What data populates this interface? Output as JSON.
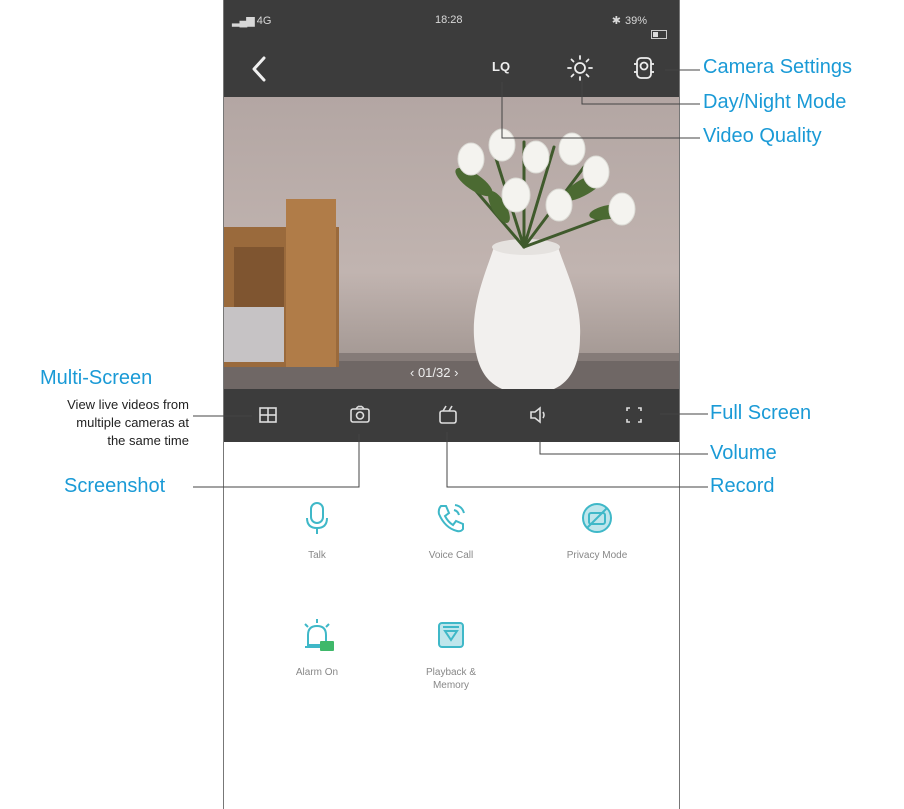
{
  "status_bar": {
    "signal": "4G",
    "time": "18:28",
    "battery": "39%"
  },
  "header": {
    "video_quality_label": "LQ"
  },
  "video": {
    "pager": "‹  01/32  ›"
  },
  "functions": [
    {
      "label": "Talk",
      "icon": "microphone-icon"
    },
    {
      "label": "Voice Call",
      "icon": "phone-call-icon"
    },
    {
      "label": "Privacy Mode",
      "icon": "privacy-mode-icon"
    },
    {
      "label": "Alarm On",
      "icon": "alarm-icon"
    },
    {
      "label": "Playback & Memory",
      "icon": "playback-icon"
    }
  ],
  "annotations": {
    "camera_settings": "Camera Settings",
    "day_night": "Day/Night Mode",
    "video_quality": "Video Quality",
    "multi_screen": "Multi-Screen",
    "multi_screen_desc_1": "View live videos from",
    "multi_screen_desc_2": "multiple cameras at",
    "multi_screen_desc_3": "the same time",
    "full_screen": "Full Screen",
    "volume": "Volume",
    "screenshot": "Screenshot",
    "record": "Record"
  },
  "colors": {
    "accent": "#1a9ad6",
    "bar": "#3c3c3c",
    "icon_teal": "#3fb8c8"
  }
}
